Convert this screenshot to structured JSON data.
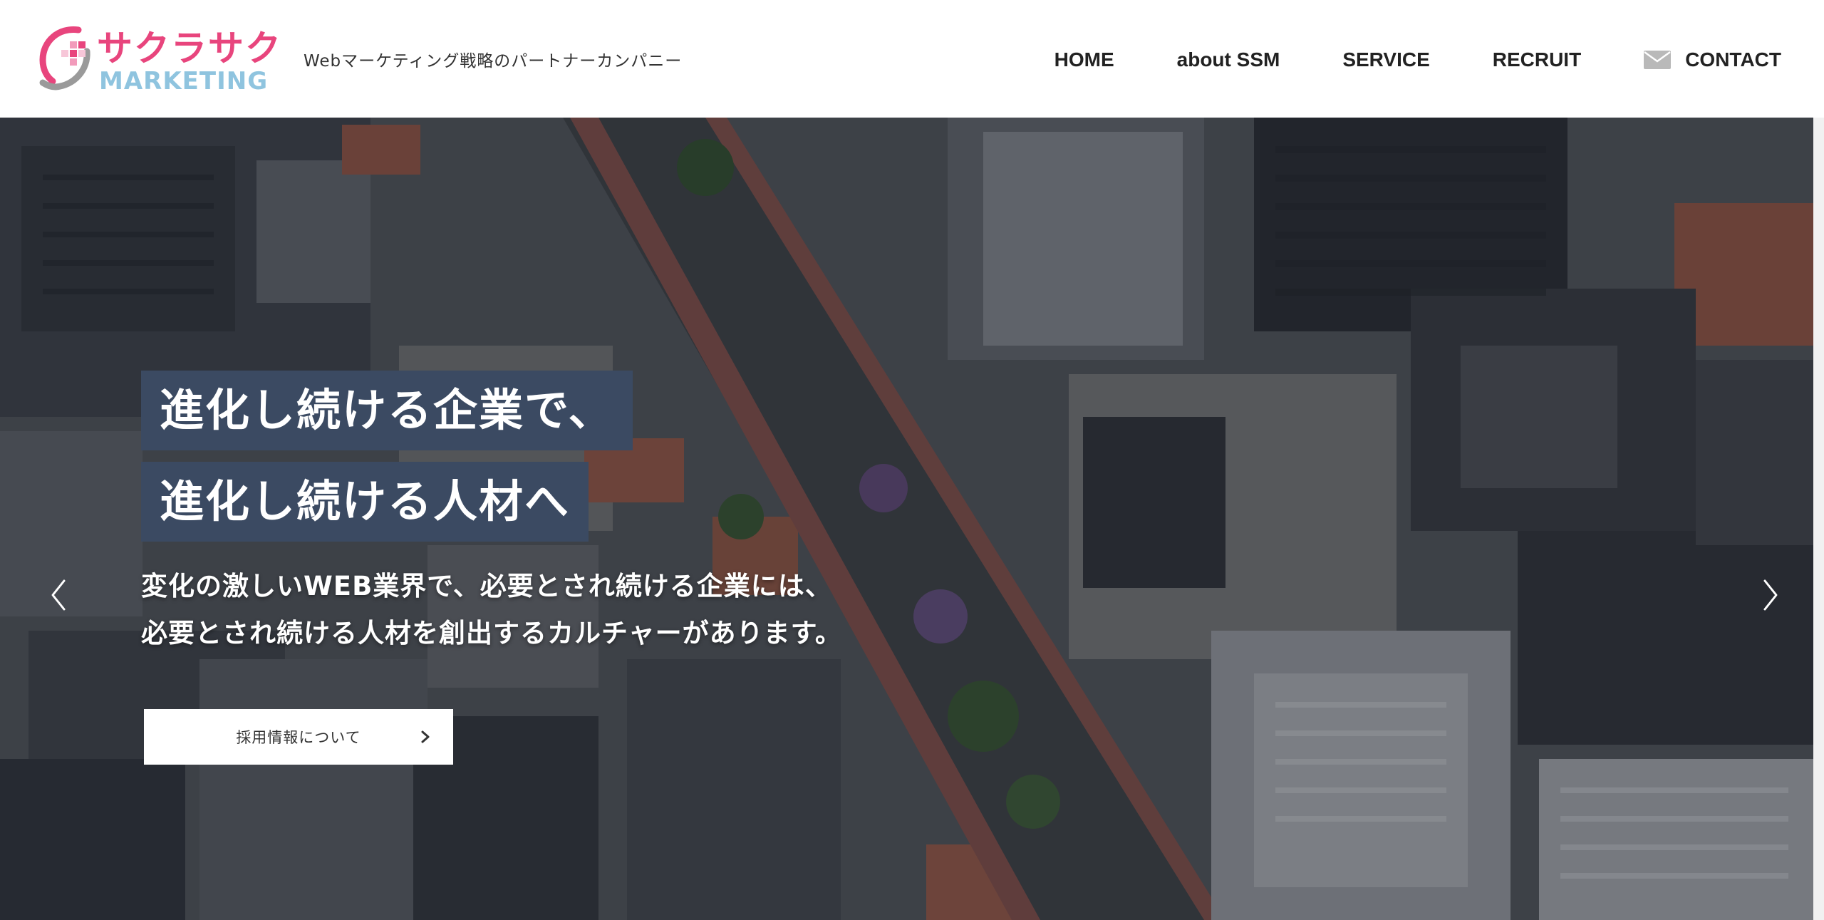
{
  "header": {
    "logo": {
      "jp": "サクラサク",
      "en": "MARKETING",
      "colors": {
        "pink": "#e8457d",
        "blue": "#8fc4df",
        "gray": "#9a9a9a"
      }
    },
    "tagline": "Webマーケティング戦略のパートナーカンパニー",
    "nav": {
      "home": "HOME",
      "about": "about SSM",
      "service": "SERVICE",
      "recruit": "RECRUIT",
      "contact": "CONTACT",
      "contact_icon": "mail-icon"
    }
  },
  "hero": {
    "headline_1": "進化し続ける企業で、",
    "headline_2": "進化し続ける人材へ",
    "subcopy_1": "変化の激しいWEB業界で、必要とされ続ける企業には、",
    "subcopy_2": "必要とされ続ける人材を創出するカルチャーがあります。",
    "button_label": "採用情報について",
    "colors": {
      "headline_bg": "#3b4a62",
      "text": "#ffffff"
    },
    "background": "aerial-city-photo"
  }
}
